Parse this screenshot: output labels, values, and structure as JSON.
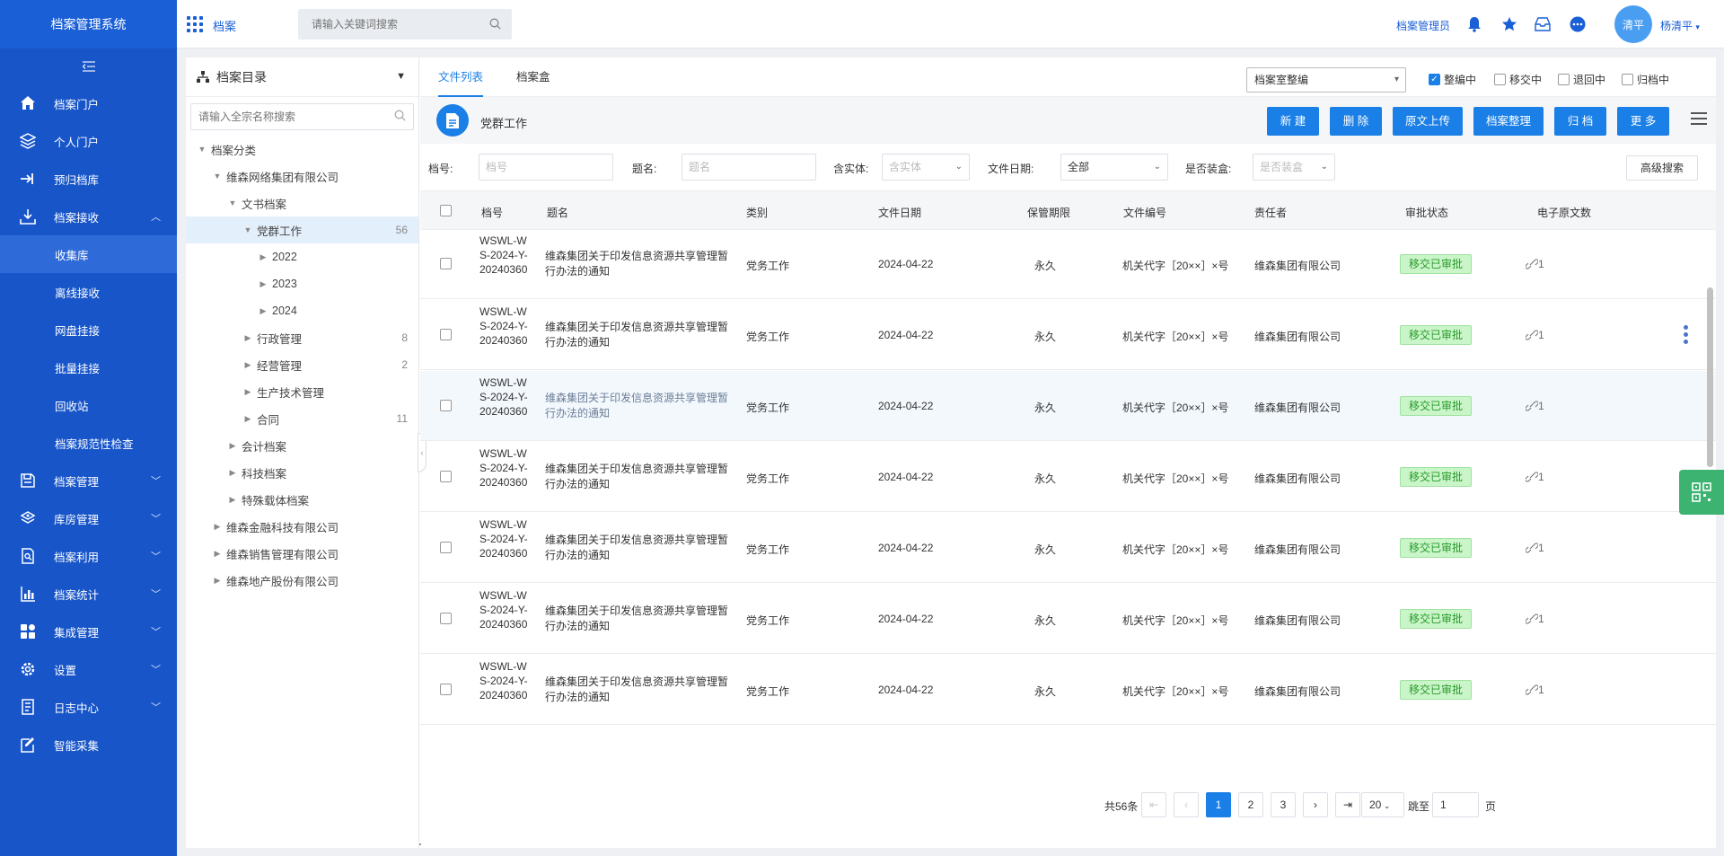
{
  "sidebar": {
    "logo": "档案管理系统",
    "items": [
      {
        "label": "档案门户",
        "icon": "home-icon"
      },
      {
        "label": "个人门户",
        "icon": "layers-icon"
      },
      {
        "label": "预归档库",
        "icon": "arrow-in-icon"
      },
      {
        "label": "档案接收",
        "icon": "download-icon",
        "expanded": true
      },
      {
        "label": "档案管理",
        "icon": "save-icon"
      },
      {
        "label": "库房管理",
        "icon": "stack-icon"
      },
      {
        "label": "档案利用",
        "icon": "doc-search-icon"
      },
      {
        "label": "档案统计",
        "icon": "bar-chart-icon"
      },
      {
        "label": "集成管理",
        "icon": "apps-icon"
      },
      {
        "label": "设置",
        "icon": "gear-icon"
      },
      {
        "label": "日志中心",
        "icon": "log-icon"
      },
      {
        "label": "智能采集",
        "icon": "edit-icon"
      }
    ],
    "sub_items": [
      "收集库",
      "离线接收",
      "网盘挂接",
      "批量挂接",
      "回收站",
      "档案规范性检查"
    ]
  },
  "header": {
    "title": "档案",
    "search_placeholder": "请输入关键词搜索",
    "role": "档案管理员",
    "avatar": "清平",
    "user": "杨清平"
  },
  "tree": {
    "title": "档案目录",
    "search_placeholder": "请输入全宗名称搜索",
    "nodes": [
      {
        "label": "档案分类",
        "level": 0,
        "open": true
      },
      {
        "label": "维森网络集团有限公司",
        "level": 1,
        "open": true
      },
      {
        "label": "文书档案",
        "level": 2,
        "open": true
      },
      {
        "label": "党群工作",
        "level": 3,
        "open": true,
        "count": "56",
        "active": true
      },
      {
        "label": "2022",
        "level": 4
      },
      {
        "label": "2023",
        "level": 4
      },
      {
        "label": "2024",
        "level": 4
      },
      {
        "label": "行政管理",
        "level": 3,
        "count": "8"
      },
      {
        "label": "经营管理",
        "level": 3,
        "count": "2"
      },
      {
        "label": "生产技术管理",
        "level": 3
      },
      {
        "label": "合同",
        "level": 3,
        "count": "11"
      },
      {
        "label": "会计档案",
        "level": 2
      },
      {
        "label": "科技档案",
        "level": 2
      },
      {
        "label": "特殊载体档案",
        "level": 2
      },
      {
        "label": "维森金融科技有限公司",
        "level": 1
      },
      {
        "label": "维森销售管理有限公司",
        "level": 1
      },
      {
        "label": "维森地产股份有限公司",
        "level": 1
      }
    ]
  },
  "tabs": [
    "文件列表",
    "档案盒"
  ],
  "status_select": "档案室整编",
  "status_filters": [
    {
      "label": "整编中",
      "checked": true
    },
    {
      "label": "移交中",
      "checked": false
    },
    {
      "label": "退回中",
      "checked": false
    },
    {
      "label": "归档中",
      "checked": false
    }
  ],
  "group_title": "党群工作",
  "buttons": [
    "新 建",
    "删 除",
    "原文上传",
    "档案整理",
    "归 档",
    "更 多"
  ],
  "filters": {
    "code_label": "档号:",
    "code_placeholder": "档号",
    "title_label": "题名:",
    "title_placeholder": "题名",
    "entity_label": "含实体:",
    "entity_placeholder": "含实体",
    "date_label": "文件日期:",
    "date_value": "全部",
    "boxed_label": "是否装盒:",
    "boxed_placeholder": "是否装盒",
    "advanced": "高级搜索"
  },
  "columns": [
    "档号",
    "题名",
    "类别",
    "文件日期",
    "保管期限",
    "文件编号",
    "责任者",
    "审批状态",
    "电子原文数"
  ],
  "rows": [
    {
      "code": "WSWL-WS-2024-Y-20240360",
      "title": "维森集团关于印发信息资源共享管理暂行办法的通知",
      "category": "党务工作",
      "date": "2024-04-22",
      "period": "永久",
      "doc_no": "机关代字［20××］×号",
      "owner": "维森集团有限公司",
      "status": "移交已审批",
      "files": "1"
    },
    {
      "code": "WSWL-WS-2024-Y-20240360",
      "title": "维森集团关于印发信息资源共享管理暂行办法的通知",
      "category": "党务工作",
      "date": "2024-04-22",
      "period": "永久",
      "doc_no": "机关代字［20××］×号",
      "owner": "维森集团有限公司",
      "status": "移交已审批",
      "files": "1"
    },
    {
      "code": "WSWL-WS-2024-Y-20240360",
      "title": "维森集团关于印发信息资源共享管理暂行办法的通知",
      "category": "党务工作",
      "date": "2024-04-22",
      "period": "永久",
      "doc_no": "机关代字［20××］×号",
      "owner": "维森集团有限公司",
      "status": "移交已审批",
      "files": "1"
    },
    {
      "code": "WSWL-WS-2024-Y-20240360",
      "title": "维森集团关于印发信息资源共享管理暂行办法的通知",
      "category": "党务工作",
      "date": "2024-04-22",
      "period": "永久",
      "doc_no": "机关代字［20××］×号",
      "owner": "维森集团有限公司",
      "status": "移交已审批",
      "files": "1"
    },
    {
      "code": "WSWL-WS-2024-Y-20240360",
      "title": "维森集团关于印发信息资源共享管理暂行办法的通知",
      "category": "党务工作",
      "date": "2024-04-22",
      "period": "永久",
      "doc_no": "机关代字［20××］×号",
      "owner": "维森集团有限公司",
      "status": "移交已审批",
      "files": "1"
    },
    {
      "code": "WSWL-WS-2024-Y-20240360",
      "title": "维森集团关于印发信息资源共享管理暂行办法的通知",
      "category": "党务工作",
      "date": "2024-04-22",
      "period": "永久",
      "doc_no": "机关代字［20××］×号",
      "owner": "维森集团有限公司",
      "status": "移交已审批",
      "files": "1"
    },
    {
      "code": "WSWL-WS-2024-Y-20240360",
      "title": "维森集团关于印发信息资源共享管理暂行办法的通知",
      "category": "党务工作",
      "date": "2024-04-22",
      "period": "永久",
      "doc_no": "机关代字［20××］×号",
      "owner": "维森集团有限公司",
      "status": "移交已审批",
      "files": "1"
    }
  ],
  "pager": {
    "total": "共56条",
    "pages": [
      "1",
      "2",
      "3"
    ],
    "current": "1",
    "page_size": "20",
    "jump_label": "跳至",
    "jump_value": "1",
    "page_unit": "页"
  }
}
